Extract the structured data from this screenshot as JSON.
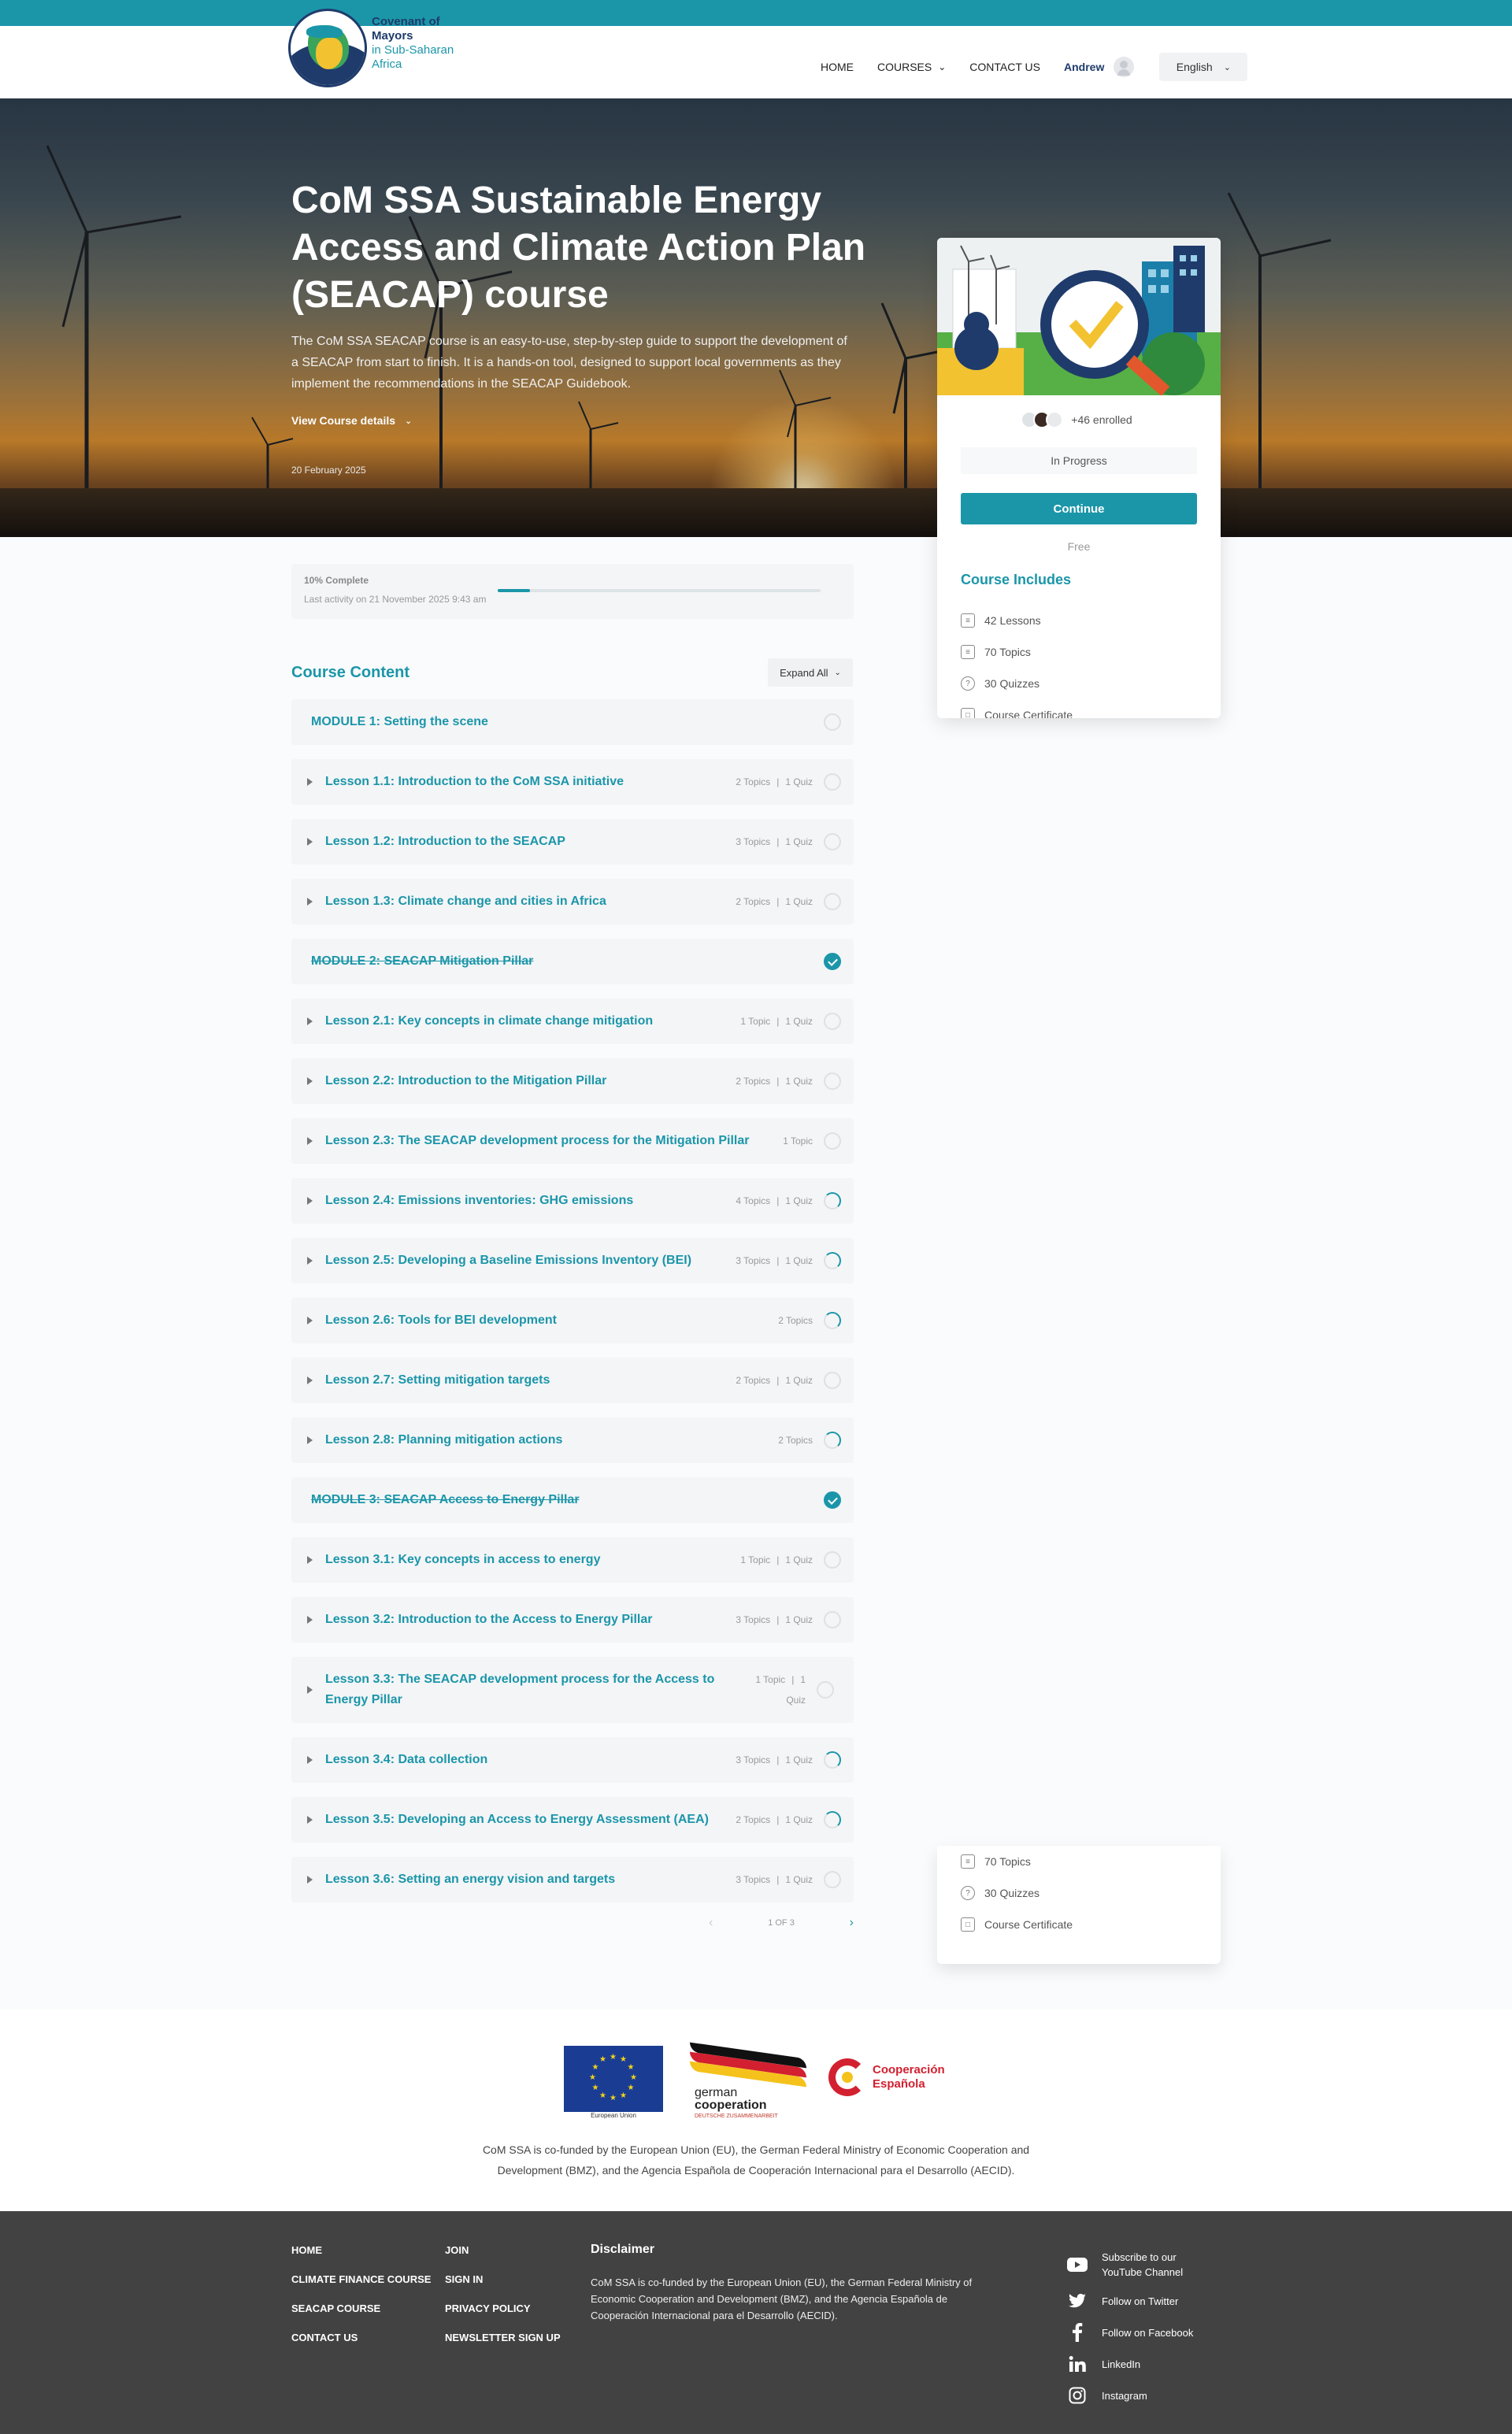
{
  "header": {
    "logo_line1": "Covenant of Mayors",
    "logo_line2": "in Sub-Saharan Africa",
    "nav": {
      "home": "HOME",
      "courses": "COURSES",
      "contact": "CONTACT US",
      "user": "Andrew"
    },
    "language": "English"
  },
  "hero": {
    "title": "CoM SSA Sustainable Energy Access and Climate Action Plan (SEACAP) course",
    "description": "The CoM SSA SEACAP course is an easy-to-use, step-by-step guide to support the development of a SEACAP from start to finish. It is a hands-on tool, designed to support local governments as they implement the recommendations in the SEACAP Guidebook.",
    "view_details": "View Course details",
    "date": "20 February 2025"
  },
  "sidebar": {
    "enrolled": "+46 enrolled",
    "status": "In Progress",
    "continue": "Continue",
    "price": "Free",
    "includes_title": "Course Includes",
    "includes": [
      "42 Lessons",
      "70 Topics",
      "30 Quizzes",
      "Course Certificate"
    ]
  },
  "progress": {
    "percent_label": "10% Complete",
    "last_activity": "Last activity on 21 November 2025 9:43 am",
    "percent": 10
  },
  "content": {
    "title": "Course Content",
    "expand": "Expand All",
    "rows": [
      {
        "type": "module",
        "title": "MODULE 1: Setting the scene",
        "status": "empty"
      },
      {
        "type": "lesson",
        "title": "Lesson 1.1: Introduction to the CoM SSA initiative",
        "topics": "2 Topics",
        "quiz": "1 Quiz",
        "status": "empty"
      },
      {
        "type": "lesson",
        "title": "Lesson 1.2: Introduction to the SEACAP",
        "topics": "3 Topics",
        "quiz": "1 Quiz",
        "status": "empty"
      },
      {
        "type": "lesson",
        "title": "Lesson 1.3: Climate change and cities in Africa",
        "topics": "2 Topics",
        "quiz": "1 Quiz",
        "status": "empty"
      },
      {
        "type": "module",
        "title": "MODULE 2: SEACAP Mitigation Pillar",
        "status": "complete"
      },
      {
        "type": "lesson",
        "title": "Lesson 2.1: Key concepts in climate change mitigation",
        "topics": "1 Topic",
        "quiz": "1 Quiz",
        "status": "empty"
      },
      {
        "type": "lesson",
        "title": "Lesson 2.2: Introduction to the Mitigation Pillar",
        "topics": "2 Topics",
        "quiz": "1 Quiz",
        "status": "empty"
      },
      {
        "type": "lesson",
        "title": "Lesson 2.3: The SEACAP development process for the Mitigation Pillar",
        "topics": "1 Topic",
        "quiz": "",
        "status": "empty"
      },
      {
        "type": "lesson",
        "title": "Lesson 2.4: Emissions inventories: GHG emissions",
        "topics": "4 Topics",
        "quiz": "1 Quiz",
        "status": "partial"
      },
      {
        "type": "lesson",
        "title": "Lesson 2.5: Developing a Baseline Emissions Inventory (BEI)",
        "topics": "3 Topics",
        "quiz": "1 Quiz",
        "status": "partial"
      },
      {
        "type": "lesson",
        "title": "Lesson 2.6: Tools for BEI development",
        "topics": "2 Topics",
        "quiz": "",
        "status": "partial"
      },
      {
        "type": "lesson",
        "title": "Lesson 2.7: Setting mitigation targets",
        "topics": "2 Topics",
        "quiz": "1 Quiz",
        "status": "empty"
      },
      {
        "type": "lesson",
        "title": "Lesson 2.8: Planning mitigation actions",
        "topics": "2 Topics",
        "quiz": "",
        "status": "partial"
      },
      {
        "type": "module",
        "title": "MODULE 3: SEACAP Access to Energy Pillar",
        "status": "complete"
      },
      {
        "type": "lesson",
        "title": "Lesson 3.1: Key concepts in access to energy",
        "topics": "1 Topic",
        "quiz": "1 Quiz",
        "status": "empty"
      },
      {
        "type": "lesson",
        "title": "Lesson 3.2: Introduction to the Access to Energy Pillar",
        "topics": "3 Topics",
        "quiz": "1 Quiz",
        "status": "empty"
      },
      {
        "type": "lesson",
        "title": "Lesson 3.3: The SEACAP development process for the Access to Energy Pillar",
        "topics": "1 Topic",
        "quiz": "1 Quiz",
        "status": "empty",
        "tall": true
      },
      {
        "type": "lesson",
        "title": "Lesson 3.4: Data collection",
        "topics": "3 Topics",
        "quiz": "1 Quiz",
        "status": "partial"
      },
      {
        "type": "lesson",
        "title": "Lesson 3.5: Developing an Access to Energy Assessment (AEA)",
        "topics": "2 Topics",
        "quiz": "1 Quiz",
        "status": "partial"
      },
      {
        "type": "lesson",
        "title": "Lesson 3.6: Setting an energy vision and targets",
        "topics": "3 Topics",
        "quiz": "1 Quiz",
        "status": "empty"
      }
    ],
    "pager": "1 OF 3"
  },
  "funders": {
    "eu_caption": "European Union",
    "german_line1": "german",
    "german_line2": "cooperation",
    "german_sub": "DEUTSCHE ZUSAMMENARBEIT",
    "spain_line1": "Cooperación",
    "spain_line2": "Española",
    "text": "CoM SSA is co-funded by the European Union (EU), the German Federal Ministry of Economic Cooperation and Development (BMZ), and the Agencia Española de Cooperación Internacional para el Desarrollo (AECID)."
  },
  "footer": {
    "col1": [
      "HOME",
      "CLIMATE FINANCE COURSE",
      "SEACAP COURSE",
      "CONTACT US"
    ],
    "col2": [
      "JOIN",
      "SIGN IN",
      "PRIVACY POLICY",
      "NEWSLETTER SIGN UP"
    ],
    "disclaimer_title": "Disclaimer",
    "disclaimer_text": "CoM SSA is co-funded by the European Union (EU), the German Federal Ministry of Economic Cooperation and Development (BMZ), and the Agencia Española de Cooperación Internacional para el Desarrollo (AECID).",
    "social": [
      "Subscribe to our YouTube Channel",
      "Follow on Twitter",
      "Follow on Facebook",
      "LinkedIn",
      "Instagram"
    ]
  },
  "colors": {
    "accent": "#1b96a9",
    "navy": "#1f3b6b",
    "footer_bg": "#424242"
  }
}
